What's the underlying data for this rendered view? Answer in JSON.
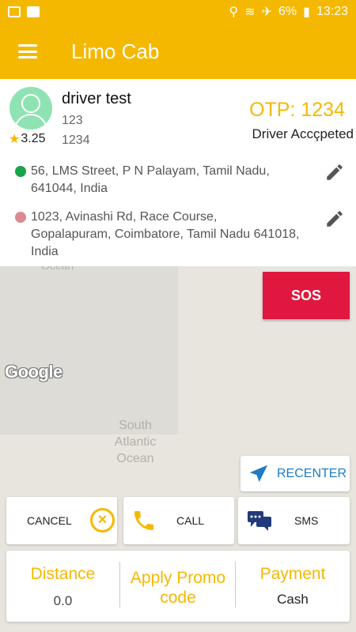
{
  "status_bar": {
    "battery": "6%",
    "time": "13:23"
  },
  "app_bar": {
    "title": "Limo Cab"
  },
  "driver": {
    "name": "driver test",
    "line1": "123",
    "line2": "1234",
    "rating": "3.25",
    "otp": "OTP: 1234",
    "status": "Driver Accçpeted"
  },
  "trip": {
    "pickup": "56, LMS Street, P N Palayam, Tamil Nadu, 641044, India",
    "drop": "1023, Avinashi Rd, Race Course, Gopalapuram, Coimbatore, Tamil Nadu 641018, India",
    "pickup_color": "#1aa34a",
    "drop_color": "#d98a94"
  },
  "map": {
    "ocean_top": "Ocean",
    "ocean_label": "South Atlantic Ocean",
    "google_logo": "Google"
  },
  "buttons": {
    "sos": "SOS",
    "recenter": "RECENTER",
    "cancel": "CANCEL",
    "call": "CALL",
    "sms": "SMS"
  },
  "fare": {
    "distance_label": "Distance",
    "distance_value": "0.0",
    "promo_label": "Apply Promo code",
    "payment_label": "Payment",
    "payment_value": "Cash"
  },
  "colors": {
    "accent": "#f5b800",
    "sos": "#e0173f",
    "recenter": "#1e7cc4",
    "sms_icon": "#233a7a"
  },
  "icons": [
    "menu-icon",
    "star-icon",
    "edit-icon",
    "navigation-arrow-icon",
    "cancel-circle-icon",
    "phone-icon",
    "chat-bubbles-icon"
  ]
}
